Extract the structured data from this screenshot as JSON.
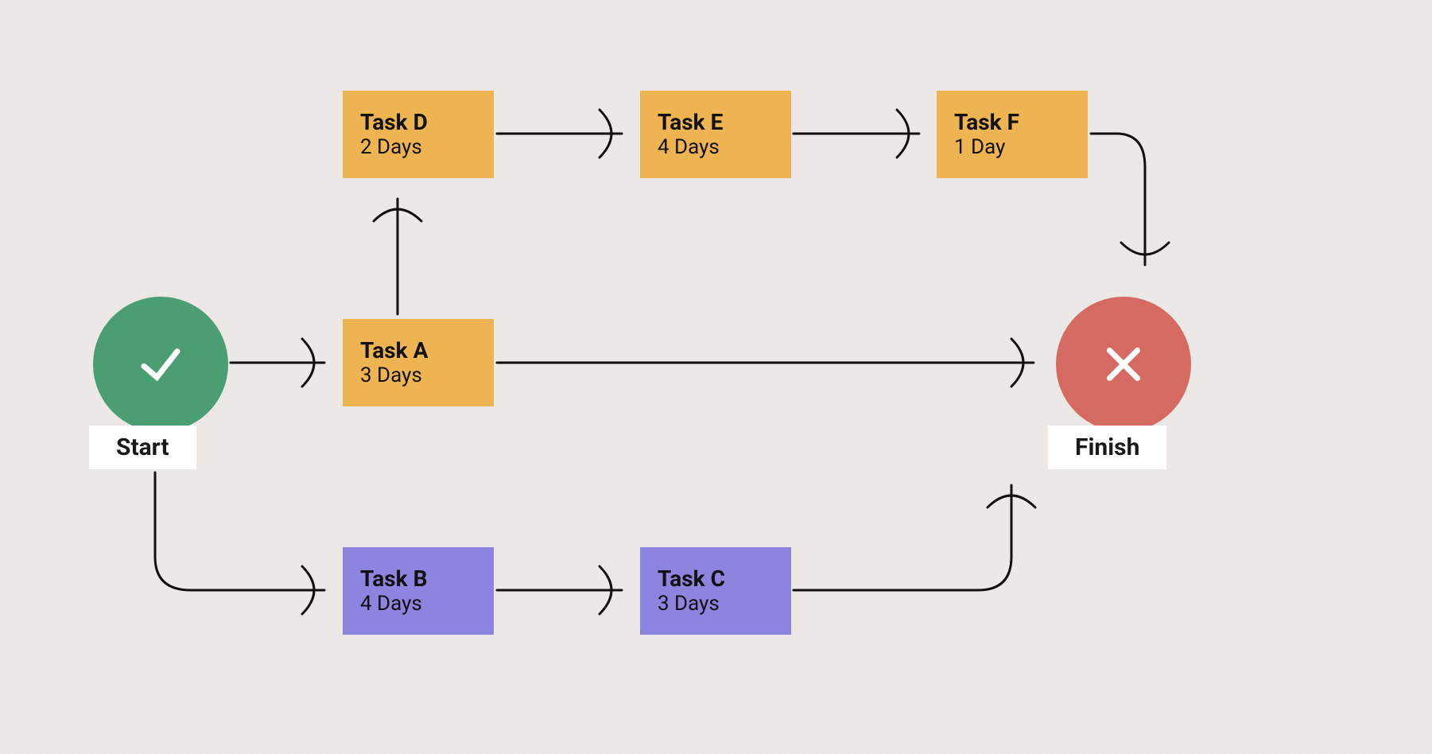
{
  "start": {
    "label": "Start"
  },
  "finish": {
    "label": "Finish"
  },
  "tasks": {
    "a": {
      "title": "Task A",
      "duration": "3 Days"
    },
    "b": {
      "title": "Task B",
      "duration": "4 Days"
    },
    "c": {
      "title": "Task C",
      "duration": "3 Days"
    },
    "d": {
      "title": "Task D",
      "duration": "2 Days"
    },
    "e": {
      "title": "Task E",
      "duration": "4 Days"
    },
    "f": {
      "title": "Task F",
      "duration": "1 Day"
    }
  },
  "colors": {
    "start_circle": "#4b9e74",
    "finish_circle": "#d46a62",
    "path_top": "#eeb451",
    "path_bottom": "#8d84e0",
    "background": "#ece8e5"
  },
  "edges": [
    [
      "Start",
      "Task A"
    ],
    [
      "Start",
      "Task B"
    ],
    [
      "Task A",
      "Task D"
    ],
    [
      "Task A",
      "Finish"
    ],
    [
      "Task D",
      "Task E"
    ],
    [
      "Task E",
      "Task F"
    ],
    [
      "Task F",
      "Finish"
    ],
    [
      "Task B",
      "Task C"
    ],
    [
      "Task C",
      "Finish"
    ]
  ]
}
